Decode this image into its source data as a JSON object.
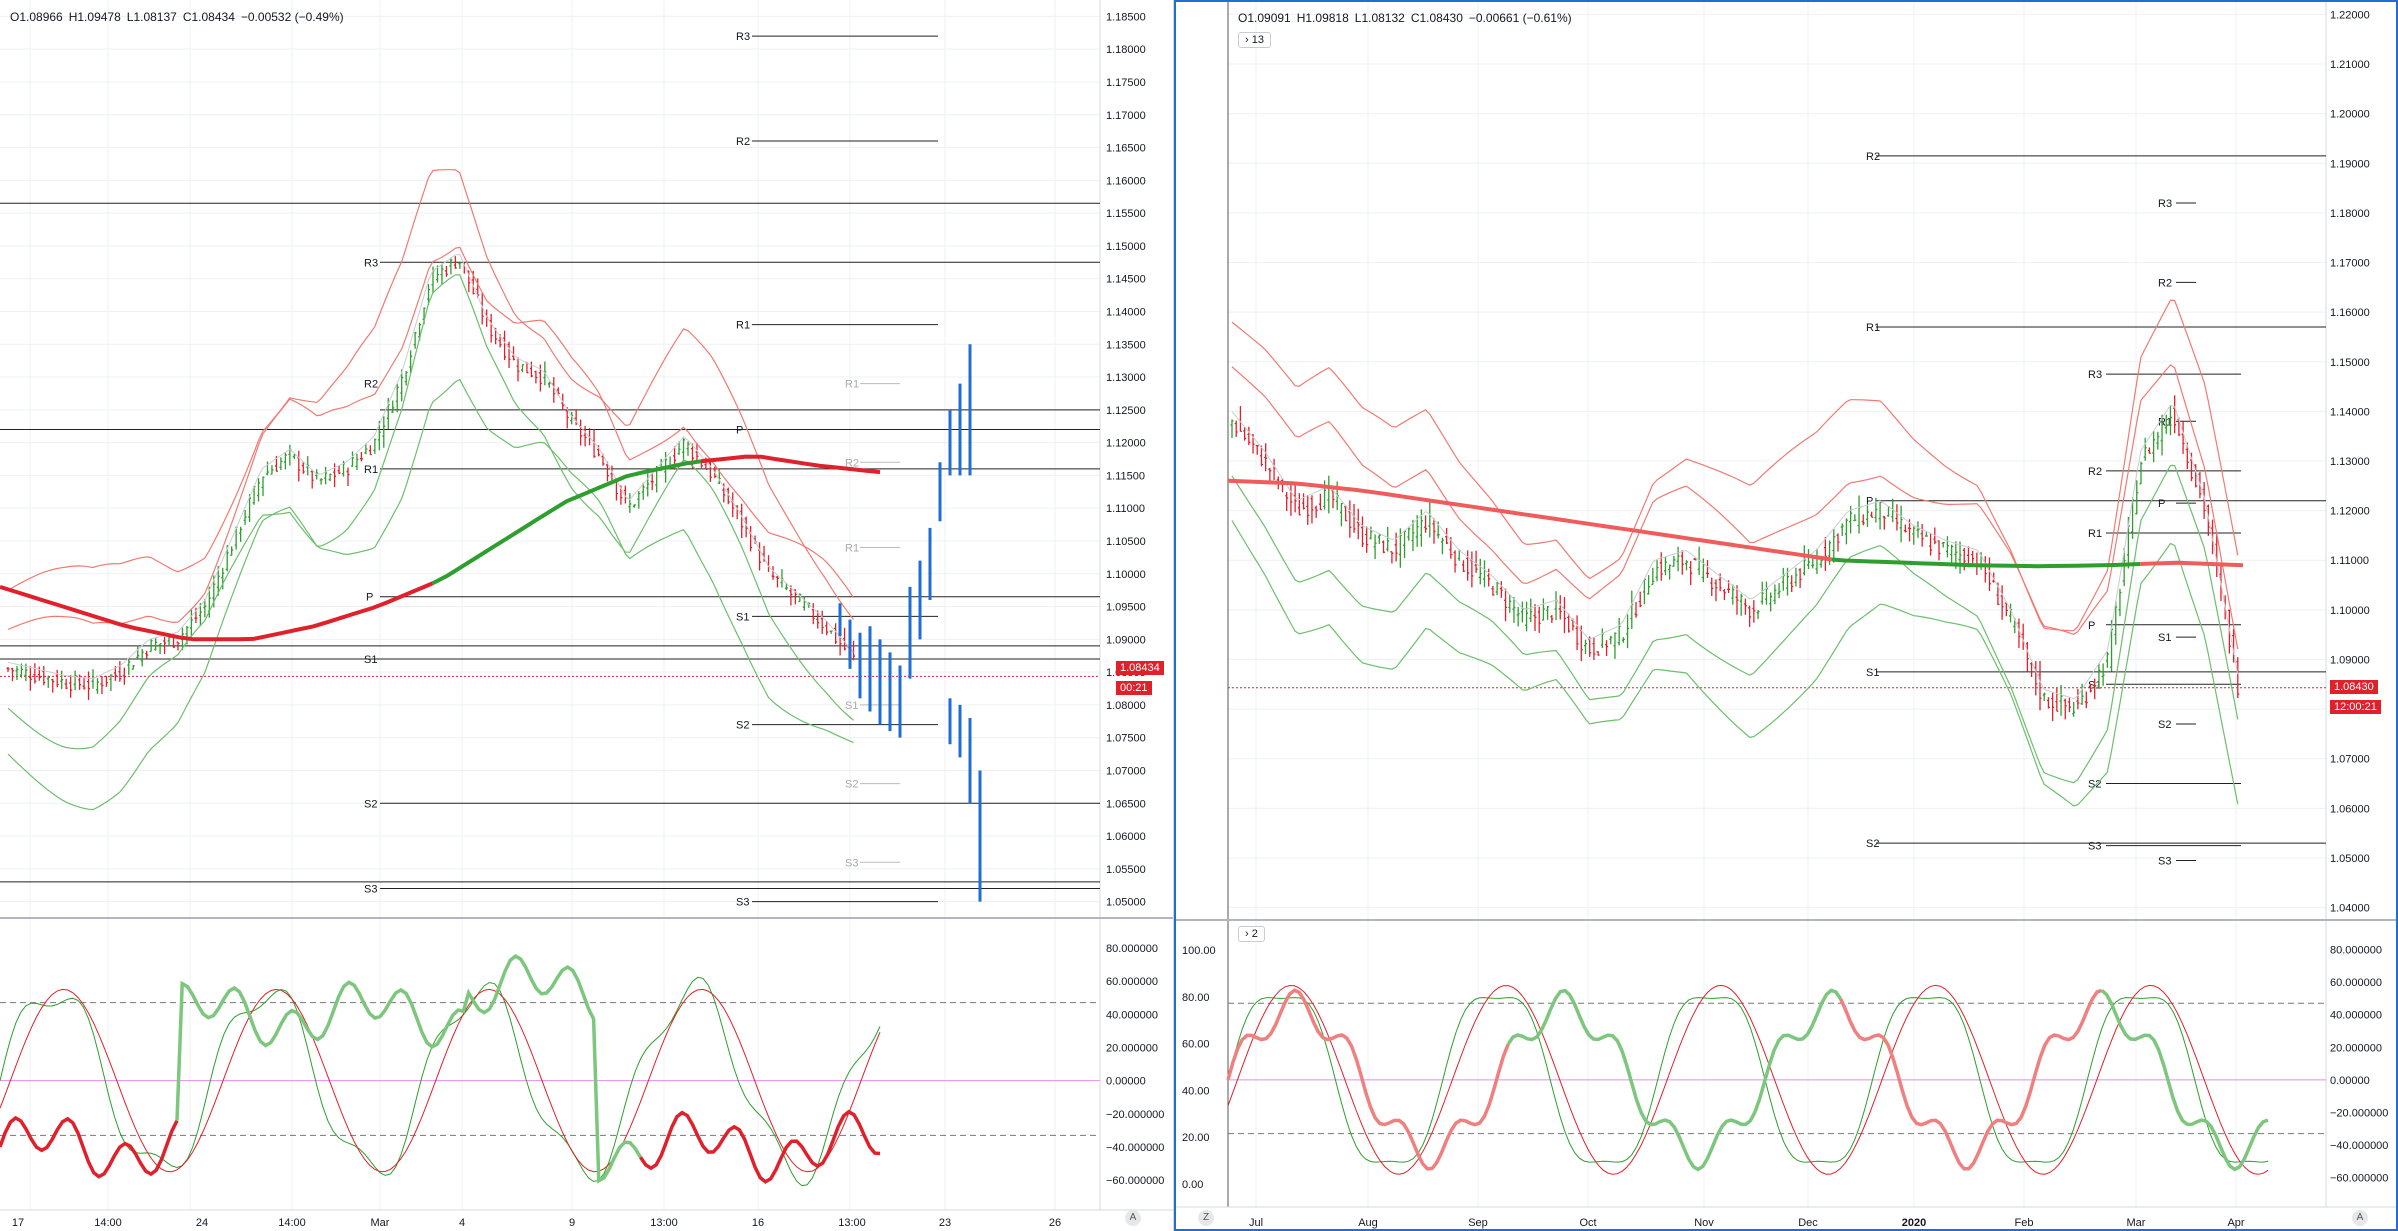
{
  "left_chart": {
    "ohlc": {
      "o": "O1.08966",
      "h": "H1.09478",
      "l": "L1.08137",
      "c": "C1.08434",
      "chg": "−0.00532 (−0.49%)"
    },
    "price_ticks": [
      "1.18500",
      "1.18000",
      "1.17500",
      "1.17000",
      "1.16500",
      "1.16000",
      "1.15500",
      "1.15000",
      "1.14500",
      "1.14000",
      "1.13500",
      "1.13000",
      "1.12500",
      "1.12000",
      "1.11500",
      "1.11000",
      "1.10500",
      "1.10000",
      "1.09500",
      "1.09000",
      "1.08500",
      "1.08000",
      "1.07500",
      "1.07000",
      "1.06500",
      "1.06000",
      "1.05500",
      "1.05000"
    ],
    "price_badge": "1.08434",
    "timer_badge": "00:21",
    "osc_ticks": [
      "80.000000",
      "60.000000",
      "40.000000",
      "20.000000",
      "0.00000",
      "−20.000000",
      "−40.000000",
      "−60.000000"
    ],
    "time_labels": [
      "17",
      "14:00",
      "24",
      "14:00",
      "Mar",
      "4",
      "9",
      "13:00",
      "16",
      "13:00",
      "23",
      "26"
    ],
    "pivot_labels": [
      "R3",
      "R2",
      "R1",
      "P",
      "S1",
      "S2",
      "S3",
      "R3",
      "R2",
      "R1",
      "P",
      "S1",
      "S2",
      "S3",
      "R1",
      "S1",
      "S2",
      "S3"
    ],
    "corner_right": "A"
  },
  "right_chart": {
    "ohlc": {
      "o": "O1.09091",
      "h": "H1.09818",
      "l": "L1.08132",
      "c": "C1.08430",
      "chg": "−0.00661 (−0.61%)"
    },
    "chip_top": "13",
    "chip_osc": "2",
    "price_ticks": [
      "1.22000",
      "1.21000",
      "1.20000",
      "1.19000",
      "1.18000",
      "1.17000",
      "1.16000",
      "1.15000",
      "1.14000",
      "1.13000",
      "1.12000",
      "1.11000",
      "1.10000",
      "1.09000",
      "1.08000",
      "1.07000",
      "1.06000",
      "1.05000",
      "1.04000"
    ],
    "price_badge": "1.08430",
    "timer_badge": "12:00:21",
    "osc_ticks": [
      "80.000000",
      "60.000000",
      "40.000000",
      "20.000000",
      "0.00000",
      "−20.000000",
      "−40.000000",
      "−60.000000"
    ],
    "osc_left_ticks": [
      "100.00",
      "80.00",
      "60.00",
      "40.00",
      "20.00",
      "0.00"
    ],
    "time_labels": [
      "Jul",
      "Aug",
      "Sep",
      "Oct",
      "Nov",
      "Dec",
      "2020",
      "Feb",
      "Mar",
      "Apr"
    ],
    "pivot_labels": [
      "R2",
      "R3",
      "R2",
      "R1",
      "R3",
      "R1",
      "R2",
      "P",
      "P",
      "R1",
      "P",
      "S1",
      "S1",
      "S1",
      "S2",
      "S2",
      "S2",
      "S3",
      "S3"
    ],
    "corner_left": "Z",
    "corner_right": "A"
  },
  "colors": {
    "up": "#2e9e2e",
    "down": "#e0202b",
    "blue": "#1e6fd1",
    "band_red": "#f07a72",
    "band_green": "#6cbf6c",
    "grid": "#eef0f3"
  }
}
